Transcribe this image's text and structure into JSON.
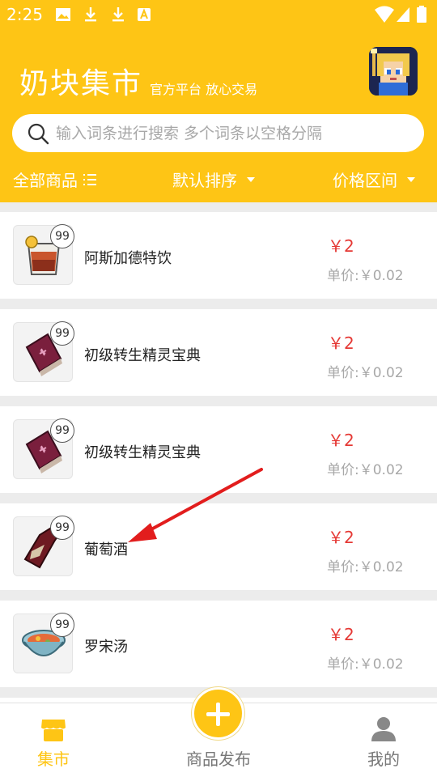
{
  "status": {
    "time": "2:25"
  },
  "header": {
    "title": "奶块集市",
    "subtitle": "官方平台 放心交易",
    "accent": "#fec515"
  },
  "search": {
    "placeholder": "输入词条进行搜索 多个词条以空格分隔"
  },
  "filters": {
    "all": "全部商品",
    "sort": "默认排序",
    "price_range": "价格区间"
  },
  "items": [
    {
      "name": "阿斯加德特饮",
      "qty": "99",
      "price": "￥2",
      "unit": "单价:￥0.02",
      "icon": "drink-icon"
    },
    {
      "name": "初级转生精灵宝典",
      "qty": "99",
      "price": "￥2",
      "unit": "单价:￥0.02",
      "icon": "spellbook-icon"
    },
    {
      "name": "初级转生精灵宝典",
      "qty": "99",
      "price": "￥2",
      "unit": "单价:￥0.02",
      "icon": "spellbook-icon"
    },
    {
      "name": "葡萄酒",
      "qty": "99",
      "price": "￥2",
      "unit": "单价:￥0.02",
      "icon": "wine-bottle-icon"
    },
    {
      "name": "罗宋汤",
      "qty": "99",
      "price": "￥2",
      "unit": "单价:￥0.02",
      "icon": "soup-bowl-icon"
    }
  ],
  "tabs": {
    "market": "集市",
    "publish": "商品发布",
    "mine": "我的"
  },
  "colors": {
    "price": "#e53935",
    "active_tab": "#fec515",
    "inactive_tab": "#777777"
  }
}
